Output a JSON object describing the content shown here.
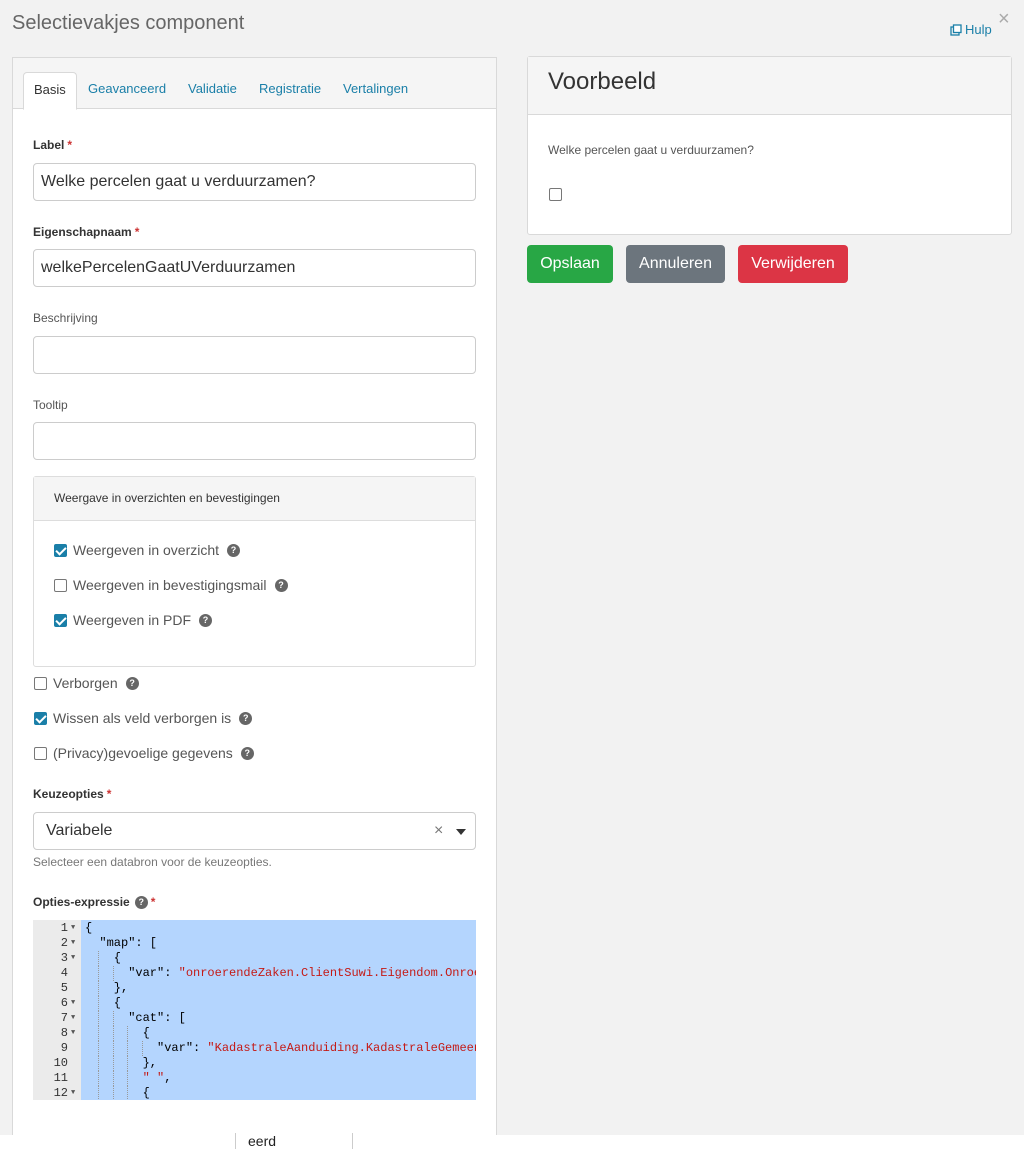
{
  "modal": {
    "title": "Selectievakjes component",
    "help_label": "Hulp",
    "close_label": "×"
  },
  "tabs": [
    {
      "label": "Basis",
      "active": true
    },
    {
      "label": "Geavanceerd"
    },
    {
      "label": "Validatie"
    },
    {
      "label": "Registratie"
    },
    {
      "label": "Vertalingen"
    }
  ],
  "form": {
    "label": {
      "title": "Label",
      "required_mark": "*",
      "value": "Welke percelen gaat u verduurzamen?"
    },
    "property_name": {
      "title": "Eigenschapnaam",
      "required_mark": "*",
      "value": "welkePercelenGaatUVerduurzamen"
    },
    "description": {
      "title": "Beschrijving",
      "value": ""
    },
    "tooltip": {
      "title": "Tooltip",
      "value": ""
    },
    "display_card": {
      "title": "Weergave in overzichten en bevestigingen",
      "options": [
        {
          "label": "Weergeven in overzicht",
          "checked": true
        },
        {
          "label": "Weergeven in bevestigingsmail",
          "checked": false
        },
        {
          "label": "Weergeven in PDF",
          "checked": true
        }
      ]
    },
    "flags": [
      {
        "label": "Verborgen",
        "checked": false
      },
      {
        "label": "Wissen als veld verborgen is",
        "checked": true
      },
      {
        "label": "(Privacy)gevoelige gegevens",
        "checked": false
      }
    ],
    "choice_options": {
      "title": "Keuzeopties",
      "required_mark": "*",
      "value": "Variabele",
      "clear_label": "×",
      "help_text": "Selecteer een databron voor de keuzeopties."
    },
    "options_expression": {
      "title": "Opties-expressie",
      "required_mark": "*",
      "help_icon": "?",
      "lines": [
        {
          "n": "1",
          "fold": true,
          "pre": "{",
          "str": "",
          "post": ""
        },
        {
          "n": "2",
          "fold": true,
          "pre": "  \"map\": [",
          "str": "",
          "post": ""
        },
        {
          "n": "3",
          "fold": true,
          "pre": "    {",
          "str": "",
          "post": ""
        },
        {
          "n": "4",
          "fold": false,
          "pre": "      \"var\": ",
          "str": "\"onroerendeZaken.ClientSuwi.Eigendom.Onroe",
          "post": ""
        },
        {
          "n": "5",
          "fold": false,
          "pre": "    },",
          "str": "",
          "post": ""
        },
        {
          "n": "6",
          "fold": true,
          "pre": "    {",
          "str": "",
          "post": ""
        },
        {
          "n": "7",
          "fold": true,
          "pre": "      \"cat\": [",
          "str": "",
          "post": ""
        },
        {
          "n": "8",
          "fold": true,
          "pre": "        {",
          "str": "",
          "post": ""
        },
        {
          "n": "9",
          "fold": false,
          "pre": "          \"var\": ",
          "str": "\"KadastraleAanduiding.KadastraleGemeen",
          "post": ""
        },
        {
          "n": "10",
          "fold": false,
          "pre": "        },",
          "str": "",
          "post": ""
        },
        {
          "n": "11",
          "fold": false,
          "pre": "        ",
          "str": "\" \"",
          "post": ","
        },
        {
          "n": "12",
          "fold": true,
          "pre": "        {",
          "str": "",
          "post": ""
        }
      ]
    }
  },
  "preview": {
    "title": "Voorbeeld",
    "question": "Welke percelen gaat u verduurzamen?",
    "checkbox_checked": false
  },
  "actions": {
    "save": "Opslaan",
    "cancel": "Annuleren",
    "delete": "Verwijderen"
  },
  "footer_fragment": "eerd",
  "colors": {
    "accent": "#1a7fa8",
    "save": "#28a745",
    "cancel": "#6c757d",
    "delete": "#dc3545",
    "selection": "#b4d5fe"
  },
  "icons": {
    "help": "external-window-icon",
    "tooltip": "question-circle-icon",
    "clear": "clear-icon",
    "dropdown": "caret-down-icon"
  }
}
